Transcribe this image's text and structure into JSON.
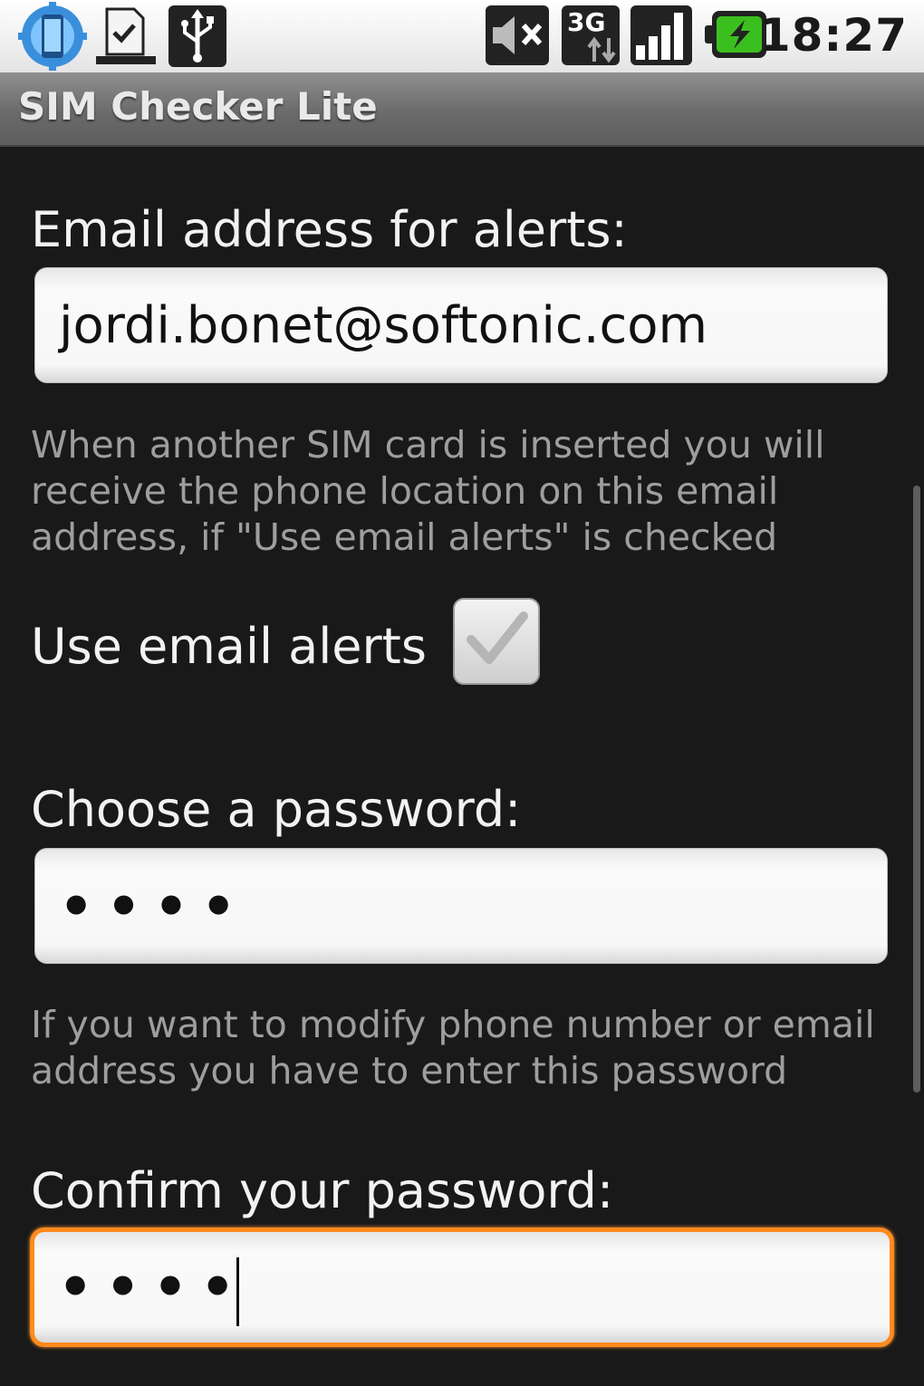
{
  "status_bar": {
    "time": "18:27",
    "network_label": "3G",
    "icons": [
      "app-notification-icon",
      "download-complete-icon",
      "usb-icon",
      "mute-icon",
      "3g-data-icon",
      "signal-icon",
      "battery-charging-icon"
    ],
    "battery_color": "#3bbf1f"
  },
  "app": {
    "title": "SIM Checker Lite"
  },
  "form": {
    "email_label": "Email address for alerts:",
    "email_value": "jordi.bonet@softonic.com",
    "email_hint": "When another SIM card is inserted you will receive the phone location on this email address, if \"Use email alerts\" is checked",
    "use_alerts_label": "Use email alerts",
    "use_alerts_checked": true,
    "password_label": "Choose a password:",
    "password_value": "••••",
    "password_hint": "If you want to modify phone number or email address you have to enter this password",
    "confirm_label": "Confirm your password:",
    "confirm_value": "••••"
  },
  "colors": {
    "focus_accent": "#ff8a1e",
    "background": "#191919"
  }
}
